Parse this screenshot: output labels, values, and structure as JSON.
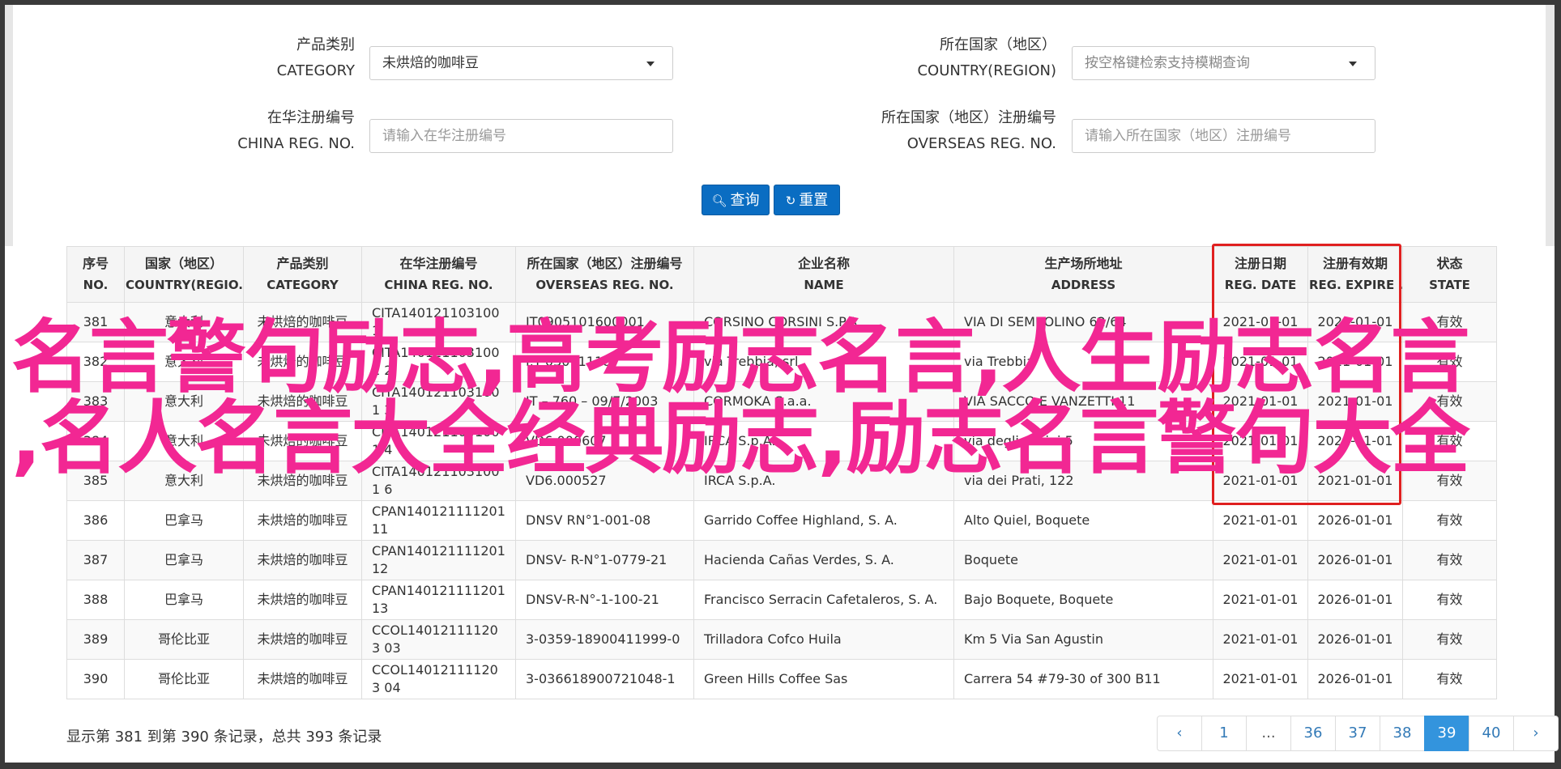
{
  "filters": {
    "category": {
      "label_cn": "产品类别",
      "label_en": "CATEGORY",
      "value": "未烘焙的咖啡豆"
    },
    "country": {
      "label_cn": "所在国家（地区）",
      "label_en": "COUNTRY(REGION)",
      "placeholder": "按空格键检索支持模糊查询"
    },
    "china_reg": {
      "label_cn": "在华注册编号",
      "label_en": "CHINA REG. NO.",
      "placeholder": "请输入在华注册编号"
    },
    "overseas_reg": {
      "label_cn": "所在国家（地区）注册编号",
      "label_en": "OVERSEAS REG. NO.",
      "placeholder": "请输入所在国家（地区）注册编号"
    },
    "search_label": "查询",
    "reset_label": "重置"
  },
  "table": {
    "headers": [
      {
        "cn": "序号",
        "en": "NO."
      },
      {
        "cn": "国家（地区）",
        "en": "COUNTRY(REGIO..."
      },
      {
        "cn": "产品类别",
        "en": "CATEGORY"
      },
      {
        "cn": "在华注册编号",
        "en": "CHINA REG. NO."
      },
      {
        "cn": "所在国家（地区）注册编号",
        "en": "OVERSEAS REG. NO."
      },
      {
        "cn": "企业名称",
        "en": "NAME"
      },
      {
        "cn": "生产场所地址",
        "en": "ADDRESS"
      },
      {
        "cn": "注册日期",
        "en": "REG. DATE"
      },
      {
        "cn": "注册有效期",
        "en": "REG. EXPIRE ..."
      },
      {
        "cn": "状态",
        "en": "STATE"
      }
    ],
    "rows": [
      [
        "381",
        "意大利",
        "未烘焙的咖啡豆",
        "CITA1401211031001",
        "IT0905101600001",
        "CORSINO CORSINI S.P.A.",
        "VIA DI SEMBOLINO 62/64",
        "2021-01-01",
        "2021-01-01",
        "有效"
      ],
      [
        "382",
        "意大利",
        "未烘焙的咖啡豆",
        "CITA1401211031001 2",
        "I.T-03011118",
        "via Trebbia, srl",
        "via Trebbia",
        "2021-01-01",
        "2021-01-01",
        "有效"
      ],
      [
        "383",
        "意大利",
        "未烘焙的咖啡豆",
        "CITA1401211031001 3",
        "IT – 760 – 09/7/2003",
        "CORMOKA S.a.a.",
        "VIA SACCO E VANZETTI 11",
        "2021-01-01",
        "2021-01-01",
        "有效"
      ],
      [
        "384",
        "意大利",
        "未烘焙的咖啡豆",
        "CITA1401211031001 4",
        "VD6.000607",
        "IRCA S.p.A.",
        "via degli Orsini 5",
        "2021-01-01",
        "2021-01-01",
        "有效"
      ],
      [
        "385",
        "意大利",
        "未烘焙的咖啡豆",
        "CITA1401211031001 6",
        "VD6.000527",
        "IRCA S.p.A.",
        "via dei Prati, 122",
        "2021-01-01",
        "2021-01-01",
        "有效"
      ],
      [
        "386",
        "巴拿马",
        "未烘焙的咖啡豆",
        "CPAN140121111201 11",
        "DNSV RN°1-001-08",
        "Garrido Coffee Highland, S. A.",
        "Alto Quiel, Boquete",
        "2021-01-01",
        "2026-01-01",
        "有效"
      ],
      [
        "387",
        "巴拿马",
        "未烘焙的咖啡豆",
        "CPAN140121111201 12",
        "DNSV- R-N°1-0779-21",
        "Hacienda Cañas Verdes, S. A.",
        "Boquete",
        "2021-01-01",
        "2026-01-01",
        "有效"
      ],
      [
        "388",
        "巴拿马",
        "未烘焙的咖啡豆",
        "CPAN140121111201 13",
        "DNSV-R-N°-1-100-21",
        "Francisco Serracin Cafetaleros, S. A.",
        "Bajo Boquete, Boquete",
        "2021-01-01",
        "2026-01-01",
        "有效"
      ],
      [
        "389",
        "哥伦比亚",
        "未烘焙的咖啡豆",
        "CCOL140121111203 03",
        "3-0359-18900411999-0",
        "Trilladora Cofco Huila",
        "Km 5 Via San Agustin",
        "2021-01-01",
        "2026-01-01",
        "有效"
      ],
      [
        "390",
        "哥伦比亚",
        "未烘焙的咖啡豆",
        "CCOL140121111203 04",
        "3-036618900721048-1",
        "Green Hills Coffee Sas",
        "Carrera 54 #79-30 of 300 B11",
        "2021-01-01",
        "2026-01-01",
        "有效"
      ]
    ]
  },
  "overlay": {
    "line1": "名言警句励志,高考励志名言,人生励志名言",
    "line2": ",名人名言大全经典励志,励志名言警句大全",
    "color": "#f22793"
  },
  "footer": {
    "summary": "显示第 381 到第 390 条记录，总共 393 条记录",
    "pages": [
      "‹",
      "1",
      "...",
      "36",
      "37",
      "38",
      "39",
      "40",
      "›"
    ],
    "active_page": "39"
  }
}
